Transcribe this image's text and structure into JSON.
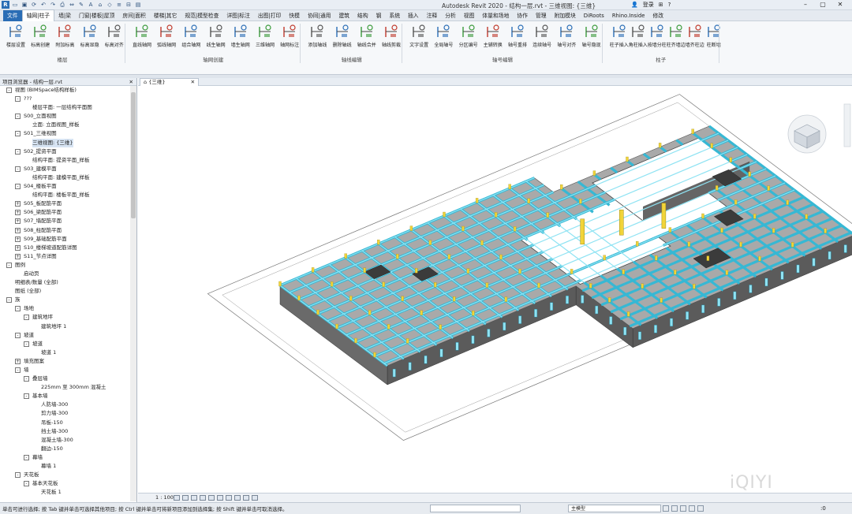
{
  "app": {
    "title": "Autodesk Revit 2020 - 结构一层.rvt - 三维视图: {三维}",
    "login": "登录",
    "logo": "R"
  },
  "ribbon_tabs": [
    "文件",
    "轴网|柱子",
    "墙|梁",
    "门窗|楼板|屋顶",
    "房间|面积",
    "楼梯|其它",
    "规范|模型检查",
    "详图|标注",
    "出图|打印",
    "快模",
    "协同|通用",
    "建筑",
    "结构",
    "钢",
    "系统",
    "插入",
    "注释",
    "分析",
    "视图",
    "体量和场地",
    "协作",
    "管理",
    "附加模块",
    "DiRoots",
    "Rhino.Inside",
    "修改"
  ],
  "active_tab": "轴网|柱子",
  "tools": [
    "楼层设置",
    "标高创建",
    "附加标高",
    "标高显隐",
    "标高对齐",
    "直线轴网",
    "弧线轴网",
    "组合轴网",
    "线生轴网",
    "墙生轴网",
    "三维轴网",
    "轴网标注",
    "添加轴线",
    "删除轴线",
    "轴线合并",
    "轴线剪裁",
    "文字设置",
    "全局轴号",
    "分区编号",
    "主辅转换",
    "轴号重排",
    "连续轴号",
    "轴号对齐",
    "轴号隐现",
    "柱子插入",
    "角柱插入",
    "按墙分柱",
    "柱齐墙边",
    "墙齐柱边",
    "柱断墙"
  ],
  "panels": [
    "楼层",
    "轴网创建",
    "轴线编辑",
    "轴号编辑",
    "柱子"
  ],
  "browser": {
    "title": "项目浏览器 - 结构一层.rvt",
    "close": "✕",
    "tree": [
      {
        "level": 0,
        "toggle": "-",
        "label": "视图 (BIMSpace结构样板)",
        "selected": false
      },
      {
        "level": 1,
        "toggle": "-",
        "label": "???",
        "selected": false
      },
      {
        "level": 2,
        "toggle": "",
        "label": "楼层平面: 一层结构平面图",
        "selected": false
      },
      {
        "level": 1,
        "toggle": "-",
        "label": "S00_立面视图",
        "selected": false
      },
      {
        "level": 2,
        "toggle": "",
        "label": "立面: 立面视图_样板",
        "selected": false
      },
      {
        "level": 1,
        "toggle": "-",
        "label": "S01_三维视图",
        "selected": false
      },
      {
        "level": 2,
        "toggle": "",
        "label": "三维视图: {三维}",
        "selected": true
      },
      {
        "level": 1,
        "toggle": "-",
        "label": "S02_提资平面",
        "selected": false
      },
      {
        "level": 2,
        "toggle": "",
        "label": "结构平面: 提资平面_样板",
        "selected": false
      },
      {
        "level": 1,
        "toggle": "-",
        "label": "S03_建模平面",
        "selected": false
      },
      {
        "level": 2,
        "toggle": "",
        "label": "结构平面: 建模平面_样板",
        "selected": false
      },
      {
        "level": 1,
        "toggle": "-",
        "label": "S04_楼板平面",
        "selected": false
      },
      {
        "level": 2,
        "toggle": "",
        "label": "结构平面: 楼板平面_样板",
        "selected": false
      },
      {
        "level": 1,
        "toggle": "+",
        "label": "S05_板配筋平面",
        "selected": false
      },
      {
        "level": 1,
        "toggle": "+",
        "label": "S06_梁配筋平面",
        "selected": false
      },
      {
        "level": 1,
        "toggle": "+",
        "label": "S07_墙配筋平面",
        "selected": false
      },
      {
        "level": 1,
        "toggle": "+",
        "label": "S08_柱配筋平面",
        "selected": false
      },
      {
        "level": 1,
        "toggle": "+",
        "label": "S09_基础配筋平面",
        "selected": false
      },
      {
        "level": 1,
        "toggle": "+",
        "label": "S10_楼梯坡道配筋详图",
        "selected": false
      },
      {
        "level": 1,
        "toggle": "+",
        "label": "S11_节点详图",
        "selected": false
      },
      {
        "level": 0,
        "toggle": "-",
        "label": "图例",
        "selected": false
      },
      {
        "level": 1,
        "toggle": "",
        "label": "启动页",
        "selected": false
      },
      {
        "level": 0,
        "toggle": "",
        "label": "明细表/数量 (全部)",
        "selected": false
      },
      {
        "level": 0,
        "toggle": "",
        "label": "图纸 (全部)",
        "selected": false
      },
      {
        "level": 0,
        "toggle": "-",
        "label": "族",
        "selected": false
      },
      {
        "level": 1,
        "toggle": "-",
        "label": "场地",
        "selected": false
      },
      {
        "level": 2,
        "toggle": "-",
        "label": "建筑地坪",
        "selected": false
      },
      {
        "level": 3,
        "toggle": "",
        "label": "建筑地坪 1",
        "selected": false
      },
      {
        "level": 1,
        "toggle": "-",
        "label": "坡道",
        "selected": false
      },
      {
        "level": 2,
        "toggle": "-",
        "label": "坡道",
        "selected": false
      },
      {
        "level": 3,
        "toggle": "",
        "label": "坡道 1",
        "selected": false
      },
      {
        "level": 1,
        "toggle": "+",
        "label": "填充图案",
        "selected": false
      },
      {
        "level": 1,
        "toggle": "-",
        "label": "墙",
        "selected": false
      },
      {
        "level": 2,
        "toggle": "-",
        "label": "叠层墙",
        "selected": false
      },
      {
        "level": 3,
        "toggle": "",
        "label": "225mm 至 300mm 混凝土",
        "selected": false
      },
      {
        "level": 2,
        "toggle": "-",
        "label": "基本墙",
        "selected": false
      },
      {
        "level": 3,
        "toggle": "",
        "label": "人防墙-300",
        "selected": false
      },
      {
        "level": 3,
        "toggle": "",
        "label": "剪力墙-300",
        "selected": false
      },
      {
        "level": 3,
        "toggle": "",
        "label": "吊板-150",
        "selected": false
      },
      {
        "level": 3,
        "toggle": "",
        "label": "挡土墙-300",
        "selected": false
      },
      {
        "level": 3,
        "toggle": "",
        "label": "混凝土墙-300",
        "selected": false
      },
      {
        "level": 3,
        "toggle": "",
        "label": "翻边-150",
        "selected": false
      },
      {
        "level": 2,
        "toggle": "-",
        "label": "幕墙",
        "selected": false
      },
      {
        "level": 3,
        "toggle": "",
        "label": "幕墙 1",
        "selected": false
      },
      {
        "level": 1,
        "toggle": "-",
        "label": "天花板",
        "selected": false
      },
      {
        "level": 2,
        "toggle": "-",
        "label": "基本天花板",
        "selected": false
      },
      {
        "level": 3,
        "toggle": "",
        "label": "天花板 1",
        "selected": false
      }
    ]
  },
  "view": {
    "tab": "{三维}",
    "tab_close": "✕",
    "scale": "1 : 100",
    "watermark": "iQIYI"
  },
  "status": {
    "message": "单击可进行选择; 按 Tab 键并单击可选择其他项目; 按 Ctrl 键并单击可将新项目添加到选择集; 按 Shift 键并单击可取消选择。",
    "model": "主模型",
    "filter": ":0"
  },
  "colors": {
    "accent": "#2a6db5",
    "beam": "#8fe3f3",
    "beam_edge": "#36b8d4",
    "slab": "#a9a9a9",
    "wall": "#5b5b5b",
    "column": "#f1d43a"
  }
}
